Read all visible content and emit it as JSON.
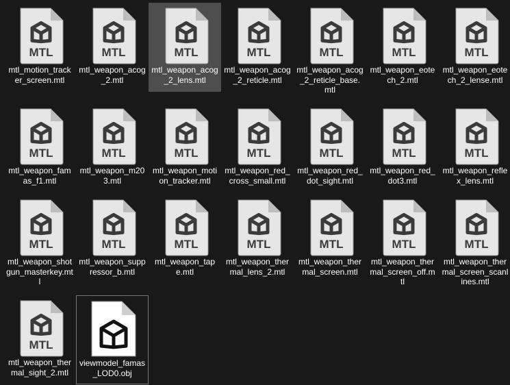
{
  "files": [
    {
      "name": "mtl_motion_tracker_screen.mtl",
      "kind": "mtl-file-icon",
      "badge": "MTL"
    },
    {
      "name": "mtl_weapon_acog_2.mtl",
      "kind": "mtl-file-icon",
      "badge": "MTL"
    },
    {
      "name": "mtl_weapon_acog_2_lens.mtl",
      "kind": "mtl-file-icon",
      "badge": "MTL",
      "selected": true
    },
    {
      "name": "mtl_weapon_acog_2_reticle.mtl",
      "kind": "mtl-file-icon",
      "badge": "MTL"
    },
    {
      "name": "mtl_weapon_acog_2_reticle_base.mtl",
      "kind": "mtl-file-icon",
      "badge": "MTL"
    },
    {
      "name": "mtl_weapon_eotech_2.mtl",
      "kind": "mtl-file-icon",
      "badge": "MTL"
    },
    {
      "name": "mtl_weapon_eotech_2_lense.mtl",
      "kind": "mtl-file-icon",
      "badge": "MTL"
    },
    {
      "name": "mtl_weapon_famas_f1.mtl",
      "kind": "mtl-file-icon",
      "badge": "MTL"
    },
    {
      "name": "mtl_weapon_m203.mtl",
      "kind": "mtl-file-icon",
      "badge": "MTL"
    },
    {
      "name": "mtl_weapon_motion_tracker.mtl",
      "kind": "mtl-file-icon",
      "badge": "MTL"
    },
    {
      "name": "mtl_weapon_red_cross_small.mtl",
      "kind": "mtl-file-icon",
      "badge": "MTL"
    },
    {
      "name": "mtl_weapon_red_dot_sight.mtl",
      "kind": "mtl-file-icon",
      "badge": "MTL"
    },
    {
      "name": "mtl_weapon_red_dot3.mtl",
      "kind": "mtl-file-icon",
      "badge": "MTL"
    },
    {
      "name": "mtl_weapon_reflex_lens.mtl",
      "kind": "mtl-file-icon",
      "badge": "MTL"
    },
    {
      "name": "mtl_weapon_shotgun_masterkey.mtl",
      "kind": "mtl-file-icon",
      "badge": "MTL"
    },
    {
      "name": "mtl_weapon_suppressor_b.mtl",
      "kind": "mtl-file-icon",
      "badge": "MTL"
    },
    {
      "name": "mtl_weapon_tape.mtl",
      "kind": "mtl-file-icon",
      "badge": "MTL"
    },
    {
      "name": "mtl_weapon_thermal_lens_2.mtl",
      "kind": "mtl-file-icon",
      "badge": "MTL"
    },
    {
      "name": "mtl_weapon_thermal_screen.mtl",
      "kind": "mtl-file-icon",
      "badge": "MTL"
    },
    {
      "name": "mtl_weapon_thermal_screen_off.mtl",
      "kind": "mtl-file-icon",
      "badge": "MTL"
    },
    {
      "name": "mtl_weapon_thermal_screen_scanlines.mtl",
      "kind": "mtl-file-icon",
      "badge": "MTL"
    },
    {
      "name": "mtl_weapon_thermal_sight_2.mtl",
      "kind": "mtl-file-icon",
      "badge": "MTL"
    },
    {
      "name": "viewmodel_famas_LOD0.obj",
      "kind": "obj-file-icon",
      "focused": true
    }
  ],
  "colors": {
    "background": "#191919",
    "mtl_icon_body": "#e6e6e6",
    "mtl_icon_fold": "#bdbdbd",
    "mtl_icon_glyph": "#3b3b3b",
    "obj_icon_body": "#ffffff",
    "obj_icon_fold": "#cfcfcf",
    "obj_icon_glyph": "#111111",
    "selected_bg": "#4d4d4d",
    "text": "#ffffff"
  }
}
